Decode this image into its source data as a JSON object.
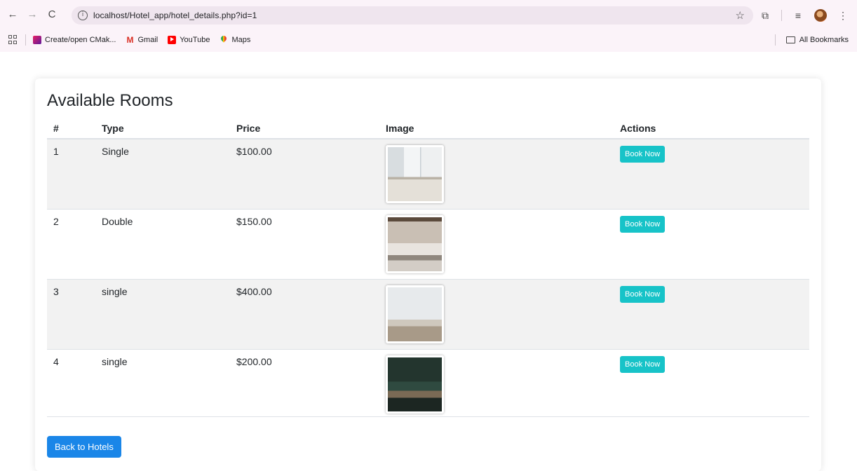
{
  "browser": {
    "url_host": "localhost",
    "url_path": "/Hotel_app/hotel_details.php?id=1",
    "bookmarks": [
      {
        "label": "Create/open CMak...",
        "icon": "cmake-icon"
      },
      {
        "label": "Gmail",
        "icon": "gmail-icon"
      },
      {
        "label": "YouTube",
        "icon": "youtube-icon"
      },
      {
        "label": "Maps",
        "icon": "maps-icon"
      }
    ],
    "all_bookmarks_label": "All Bookmarks",
    "gmail_glyph": "M"
  },
  "page": {
    "title": "Available Rooms",
    "table": {
      "headers": [
        "#",
        "Type",
        "Price",
        "Image",
        "Actions"
      ],
      "rows": [
        {
          "num": "1",
          "type": "Single",
          "price": "$100.00",
          "image": "room-photo-1",
          "action": "Book Now"
        },
        {
          "num": "2",
          "type": "Double",
          "price": "$150.00",
          "image": "room-photo-2",
          "action": "Book Now"
        },
        {
          "num": "3",
          "type": "single",
          "price": "$400.00",
          "image": "room-photo-3",
          "action": "Book Now"
        },
        {
          "num": "4",
          "type": "single",
          "price": "$200.00",
          "image": "room-photo-4",
          "action": "Book Now"
        }
      ]
    },
    "back_button": "Back to Hotels"
  },
  "colors": {
    "book_button": "#17c3c8",
    "back_button": "#1a86e8",
    "striped_row": "#f2f2f2",
    "chrome_bg": "#fbf3f9"
  }
}
